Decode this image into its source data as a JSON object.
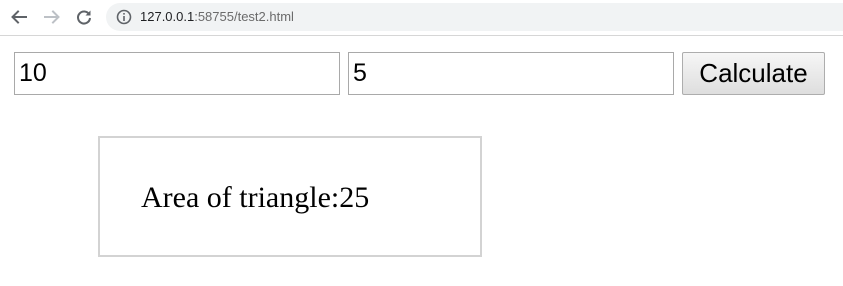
{
  "browser": {
    "url_host": "127.0.0.1",
    "url_rest": ":58755/test2.html",
    "icons": {
      "back": "arrow-left-icon",
      "forward": "arrow-right-icon",
      "reload": "reload-icon",
      "site_info": "info-icon"
    },
    "colors": {
      "omnibox_bg": "#f1f3f4",
      "nav_enabled": "#5f6368",
      "nav_disabled": "#bdc1c6"
    }
  },
  "form": {
    "input_a_value": "10",
    "input_b_value": "5",
    "calculate_label": "Calculate"
  },
  "result": {
    "text": "Area of triangle:25"
  }
}
